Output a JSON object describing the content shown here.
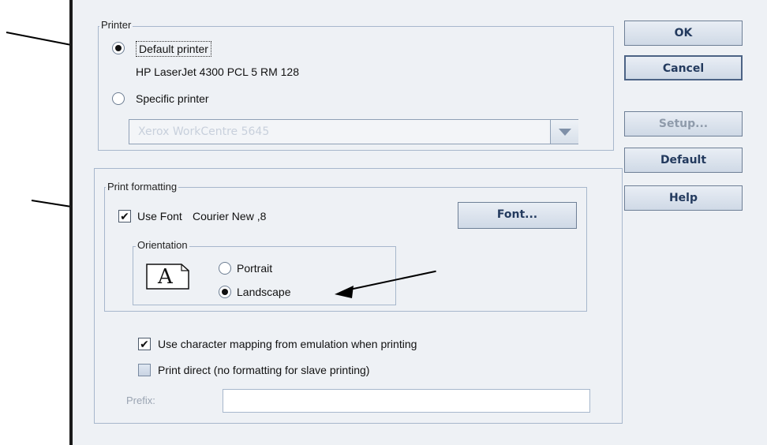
{
  "printer_group": {
    "legend": "Printer",
    "default_printer_label": "Default printer",
    "default_printer_name": "HP LaserJet 4300 PCL 5 RM 128",
    "specific_printer_label": "Specific printer",
    "specific_printer_selected": false,
    "default_printer_selected": true,
    "printer_combo_value": "Xerox WorkCentre 5645"
  },
  "format_group": {
    "legend": "Print formatting",
    "use_font_label": "Use Font",
    "use_font_checked": true,
    "font_value": "Courier New ,8",
    "font_button_label": "Font...",
    "orientation": {
      "legend": "Orientation",
      "icon_letter": "A",
      "portrait_label": "Portrait",
      "landscape_label": "Landscape",
      "selected": "Landscape"
    }
  },
  "options": {
    "char_mapping_label": "Use character mapping from emulation when printing",
    "char_mapping_checked": true,
    "print_direct_label": "Print direct (no formatting for slave printing)",
    "print_direct_checked": false,
    "prefix_label": "Prefix:",
    "prefix_value": ""
  },
  "buttons": {
    "ok": "OK",
    "cancel": "Cancel",
    "setup": "Setup...",
    "default": "Default",
    "help": "Help"
  },
  "colors": {
    "dialog_bg": "#eef1f5",
    "group_border": "#a7b7cc",
    "button_text": "#233a5e",
    "disabled_text": "#c8d0dc"
  }
}
